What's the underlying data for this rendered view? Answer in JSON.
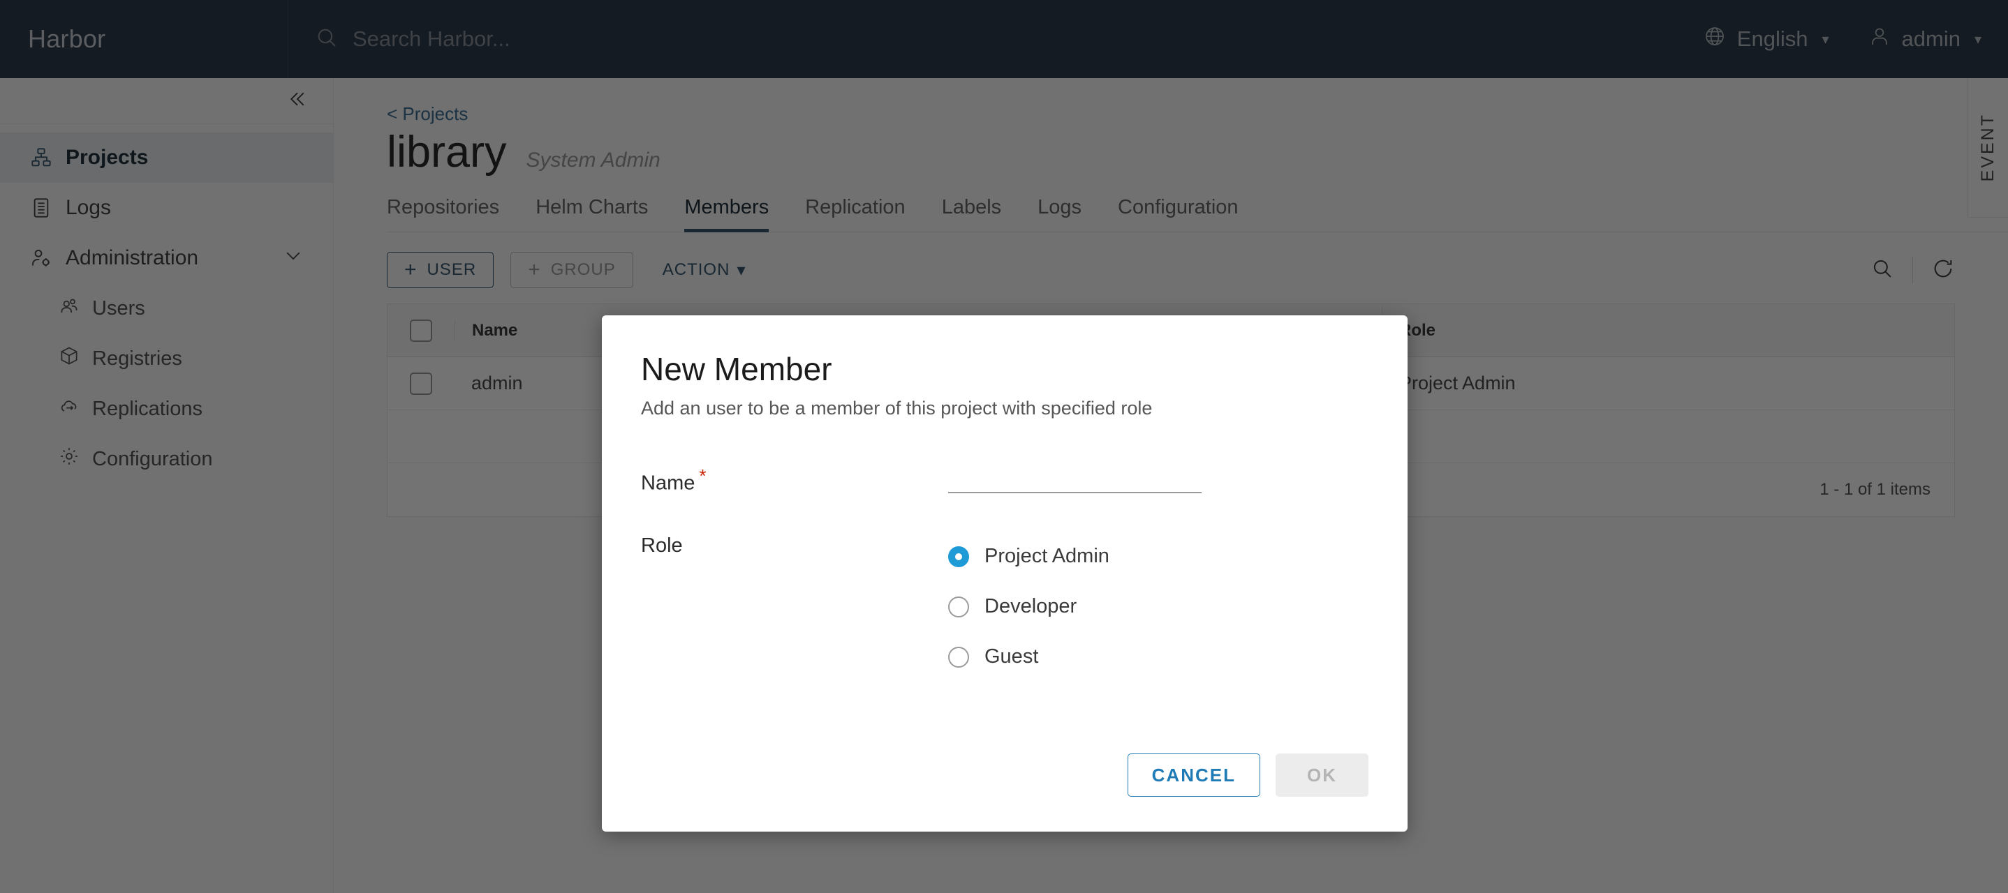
{
  "header": {
    "brand": "Harbor",
    "search_placeholder": "Search Harbor...",
    "language": "English",
    "user": "admin",
    "icons": {
      "search": "search-icon",
      "globe": "globe-icon",
      "user": "user-icon"
    }
  },
  "sidebar": {
    "collapse_icon": "double-chevron-left-icon",
    "items": [
      {
        "label": "Projects",
        "icon": "projects-icon",
        "active": true
      },
      {
        "label": "Logs",
        "icon": "logs-icon",
        "active": false
      },
      {
        "label": "Administration",
        "icon": "administration-icon",
        "active": false,
        "expanded": true
      }
    ],
    "sub_items": [
      {
        "label": "Users",
        "icon": "users-icon"
      },
      {
        "label": "Registries",
        "icon": "registries-icon"
      },
      {
        "label": "Replications",
        "icon": "replications-icon"
      },
      {
        "label": "Configuration",
        "icon": "configuration-icon"
      }
    ]
  },
  "page": {
    "breadcrumb": "< Projects",
    "title": "library",
    "subtitle": "System Admin",
    "event_rail_label": "EVENT"
  },
  "tabs": [
    {
      "label": "Repositories",
      "active": false
    },
    {
      "label": "Helm Charts",
      "active": false
    },
    {
      "label": "Members",
      "active": true
    },
    {
      "label": "Replication",
      "active": false
    },
    {
      "label": "Labels",
      "active": false
    },
    {
      "label": "Logs",
      "active": false
    },
    {
      "label": "Configuration",
      "active": false
    }
  ],
  "toolbar": {
    "add_user_label": "USER",
    "add_group_label": "GROUP",
    "action_label": "ACTION",
    "search_icon": "search-icon",
    "refresh_icon": "refresh-icon"
  },
  "table": {
    "columns": [
      "Name",
      "Role"
    ],
    "rows": [
      {
        "name": "admin",
        "role": "Project Admin"
      }
    ],
    "footer": "1 - 1 of 1 items"
  },
  "modal": {
    "title": "New Member",
    "subtitle": "Add an user to be a member of this project with specified role",
    "name_label": "Name",
    "name_required_mark": "*",
    "name_value": "",
    "name_placeholder": "",
    "role_label": "Role",
    "roles": [
      {
        "label": "Project Admin",
        "selected": true
      },
      {
        "label": "Developer",
        "selected": false
      },
      {
        "label": "Guest",
        "selected": false
      }
    ],
    "cancel_label": "CANCEL",
    "ok_label": "OK"
  },
  "colors": {
    "header_bg": "#2f3d4c",
    "accent": "#35586f",
    "link": "#3b6f94",
    "radio_selected": "#1e9ad6",
    "button_primary": "#1f7bb6",
    "required": "#c92100"
  }
}
